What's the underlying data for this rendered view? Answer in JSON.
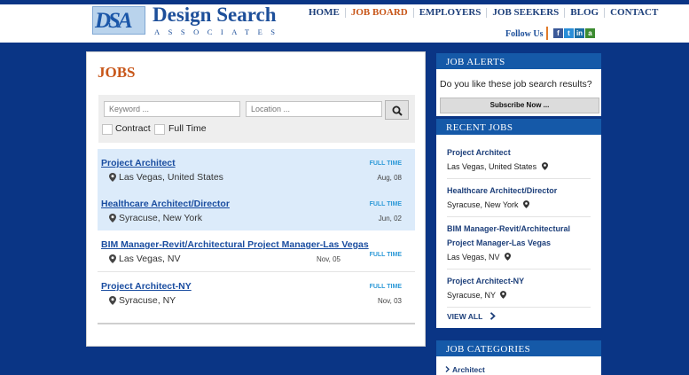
{
  "brand": {
    "logo_mark": "DSA",
    "name": "Design Search",
    "tagline": "ASSOCIATES"
  },
  "nav": {
    "items": [
      "HOME",
      "JOB BOARD",
      "EMPLOYERS",
      "JOB SEEKERS",
      "BLOG",
      "CONTACT"
    ],
    "active": "JOB BOARD"
  },
  "social": {
    "follow_label": "Follow Us",
    "icons": [
      "facebook-icon",
      "twitter-icon",
      "linkedin-icon",
      "a-icon"
    ],
    "glyphs": {
      "facebook": "f",
      "twitter": "t",
      "linkedin": "in",
      "a": "a"
    }
  },
  "jobs": {
    "title": "JOBS",
    "search": {
      "keyword_placeholder": "Keyword ...",
      "location_placeholder": "Location ..."
    },
    "filters": {
      "contract": "Contract",
      "full_time": "Full Time"
    },
    "list": [
      {
        "title": "Project Architect",
        "location": "Las Vegas, United States",
        "type": "FULL TIME",
        "date": "Aug, 08"
      },
      {
        "title": "Healthcare Architect/Director",
        "location": "Syracuse, New York",
        "type": "FULL TIME",
        "date": "Jun, 02"
      },
      {
        "title": "BIM Manager-Revit/Architectural Project Manager-Las Vegas",
        "location": "Las Vegas, NV",
        "type": "FULL TIME",
        "date": "Nov, 05"
      },
      {
        "title": "Project Architect-NY",
        "location": "Syracuse, NY",
        "type": "FULL TIME",
        "date": "Nov, 03"
      }
    ]
  },
  "sidebar": {
    "alerts": {
      "heading": "JOB ALERTS",
      "question": "Do you like these job search results?",
      "button": "Subscribe Now ..."
    },
    "recent": {
      "heading": "RECENT JOBS",
      "items": [
        {
          "title": "Project Architect",
          "location": "Las Vegas, United States"
        },
        {
          "title": "Healthcare Architect/Director",
          "location": "Syracuse, New York"
        },
        {
          "title": "BIM Manager-Revit/Architectural Project Manager-Las Vegas",
          "location": "Las Vegas, NV"
        },
        {
          "title": "Project Architect-NY",
          "location": "Syracuse, NY"
        }
      ],
      "view_all": "VIEW ALL"
    },
    "categories": {
      "heading": "JOB CATEGORIES",
      "items": [
        "Architect"
      ]
    }
  },
  "colors": {
    "background": "#0a3585",
    "accent_orange": "#c8571a",
    "link_blue": "#1a4da0",
    "sidebar_header": "#1559a8",
    "fulltime_blue": "#2f9ad8"
  }
}
